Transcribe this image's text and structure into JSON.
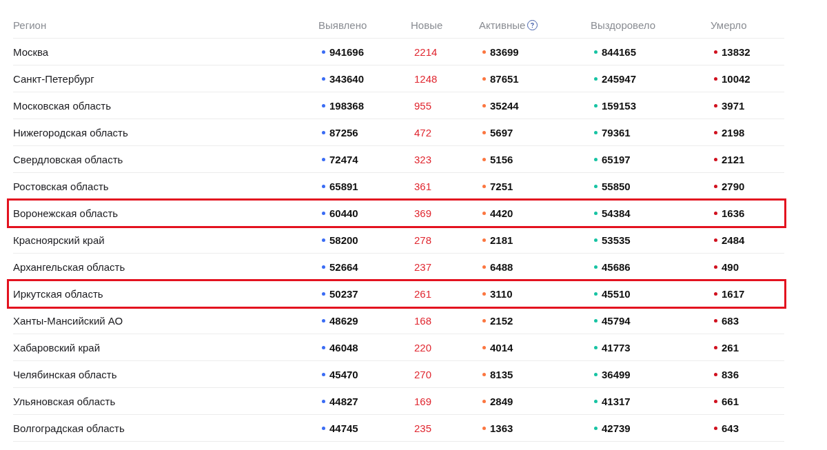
{
  "table": {
    "columns": [
      {
        "label": "Регион",
        "kind": "name",
        "help": false
      },
      {
        "label": "Выявлено",
        "kind": "dot",
        "color": "#3a6cf4",
        "help": false
      },
      {
        "label": "Новые",
        "kind": "plain",
        "color": "#e0262f",
        "help": false
      },
      {
        "label": "Активные",
        "kind": "dot",
        "color": "#fb7640",
        "help": true
      },
      {
        "label": "Выздоровело",
        "kind": "dot",
        "color": "#17c3a3",
        "help": false
      },
      {
        "label": "Умерло",
        "kind": "dot",
        "color": "#d0101e",
        "help": false
      }
    ],
    "rows": [
      {
        "cells": [
          "Москва",
          "941696",
          "2214",
          "83699",
          "844165",
          "13832"
        ],
        "highlighted": false
      },
      {
        "cells": [
          "Санкт-Петербург",
          "343640",
          "1248",
          "87651",
          "245947",
          "10042"
        ],
        "highlighted": false
      },
      {
        "cells": [
          "Московская область",
          "198368",
          "955",
          "35244",
          "159153",
          "3971"
        ],
        "highlighted": false
      },
      {
        "cells": [
          "Нижегородская область",
          "87256",
          "472",
          "5697",
          "79361",
          "2198"
        ],
        "highlighted": false
      },
      {
        "cells": [
          "Свердловская область",
          "72474",
          "323",
          "5156",
          "65197",
          "2121"
        ],
        "highlighted": false
      },
      {
        "cells": [
          "Ростовская область",
          "65891",
          "361",
          "7251",
          "55850",
          "2790"
        ],
        "highlighted": false
      },
      {
        "cells": [
          "Воронежская область",
          "60440",
          "369",
          "4420",
          "54384",
          "1636"
        ],
        "highlighted": true
      },
      {
        "cells": [
          "Красноярский край",
          "58200",
          "278",
          "2181",
          "53535",
          "2484"
        ],
        "highlighted": false
      },
      {
        "cells": [
          "Архангельская область",
          "52664",
          "237",
          "6488",
          "45686",
          "490"
        ],
        "highlighted": false
      },
      {
        "cells": [
          "Иркутская область",
          "50237",
          "261",
          "3110",
          "45510",
          "1617"
        ],
        "highlighted": true
      },
      {
        "cells": [
          "Ханты-Мансийский АО",
          "48629",
          "168",
          "2152",
          "45794",
          "683"
        ],
        "highlighted": false
      },
      {
        "cells": [
          "Хабаровский край",
          "46048",
          "220",
          "4014",
          "41773",
          "261"
        ],
        "highlighted": false
      },
      {
        "cells": [
          "Челябинская область",
          "45470",
          "270",
          "8135",
          "36499",
          "836"
        ],
        "highlighted": false
      },
      {
        "cells": [
          "Ульяновская область",
          "44827",
          "169",
          "2849",
          "41317",
          "661"
        ],
        "highlighted": false
      },
      {
        "cells": [
          "Волгоградская область",
          "44745",
          "235",
          "1363",
          "42739",
          "643"
        ],
        "highlighted": false
      }
    ]
  }
}
